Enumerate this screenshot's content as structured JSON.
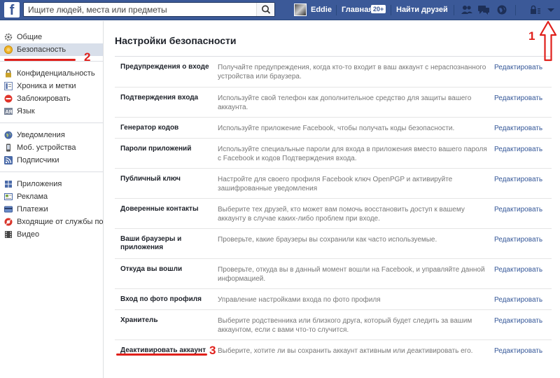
{
  "topbar": {
    "logo": "f",
    "search_placeholder": "Ищите людей, места или предметы",
    "user_name": "Eddie",
    "home_label": "Главная",
    "home_badge": "20+",
    "find_friends_label": "Найти друзей",
    "icons": [
      "friend-requests-icon",
      "messages-icon",
      "notifications-globe-icon",
      "privacy-lock-icon",
      "account-menu-arrow-icon"
    ],
    "color": "#3b5998"
  },
  "sidebar": {
    "groups": [
      [
        {
          "label": "Общие",
          "icon": "gear-icon"
        },
        {
          "label": "Безопасность",
          "icon": "security-badge-icon",
          "active": true
        }
      ],
      [
        {
          "label": "Конфиденциальность",
          "icon": "privacy-lock-icon"
        },
        {
          "label": "Хроника и метки",
          "icon": "timeline-icon"
        },
        {
          "label": "Заблокировать",
          "icon": "block-icon"
        },
        {
          "label": "Язык",
          "icon": "language-icon"
        }
      ],
      [
        {
          "label": "Уведомления",
          "icon": "globe-icon"
        },
        {
          "label": "Моб. устройства",
          "icon": "mobile-icon"
        },
        {
          "label": "Подписчики",
          "icon": "rss-icon"
        }
      ],
      [
        {
          "label": "Приложения",
          "icon": "apps-icon"
        },
        {
          "label": "Реклама",
          "icon": "ads-icon"
        },
        {
          "label": "Платежи",
          "icon": "payments-icon"
        },
        {
          "label": "Входящие от службы по...",
          "icon": "support-icon"
        },
        {
          "label": "Видео",
          "icon": "video-icon"
        }
      ]
    ]
  },
  "main": {
    "title": "Настройки безопасности",
    "edit_label": "Редактировать",
    "rows": [
      {
        "label": "Предупреждения о входе",
        "desc": "Получайте предупреждения, когда кто-то входит в ваш аккаунт с нераспознанного устройства или браузера."
      },
      {
        "label": "Подтверждения входа",
        "desc": "Используйте свой телефон как дополнительное средство для защиты вашего аккаунта."
      },
      {
        "label": "Генератор кодов",
        "desc": "Используйте приложение Facebook, чтобы получать коды безопасности."
      },
      {
        "label": "Пароли приложений",
        "desc": "Используйте специальные пароли для входа в приложения вместо вашего пароля с Facebook и кодов Подтверждения входа."
      },
      {
        "label": "Публичный ключ",
        "desc": "Настройте для своего профиля Facebook ключ OpenPGP и активируйте зашифрованные уведомления"
      },
      {
        "label": "Доверенные контакты",
        "desc": "Выберите тех друзей, кто может вам помочь восстановить доступ к вашему аккаунту в случае каких-либо проблем при входе."
      },
      {
        "label": "Ваши браузеры и приложения",
        "desc": "Проверьте, какие браузеры вы сохранили как часто используемые."
      },
      {
        "label": "Откуда вы вошли",
        "desc": "Проверьте, откуда вы в данный момент вошли на Facebook, и управляйте данной информацией."
      },
      {
        "label": "Вход по фото профиля",
        "desc": "Управление настройками входа по фото профиля"
      },
      {
        "label": "Хранитель",
        "desc": "Выберите родственника или близкого друга, который будет следить за вашим аккаунтом, если с вами что-то случится."
      },
      {
        "label": "Деактивировать аккаунт",
        "desc": "Выберите, хотите ли вы сохранить аккаунт активным или деактивировать его."
      }
    ]
  },
  "annotations": {
    "marker_1": "1",
    "marker_2": "2",
    "marker_3": "3",
    "color": "#e0201b"
  }
}
